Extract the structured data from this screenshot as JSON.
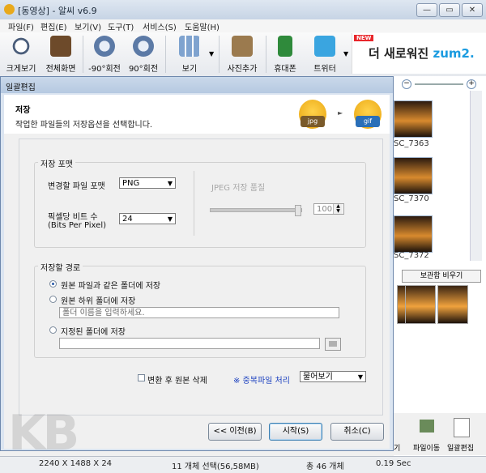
{
  "window": {
    "title": "[동영상] - 알씨 v6.9"
  },
  "menu": [
    "파일(F)",
    "편집(E)",
    "보기(V)",
    "도구(T)",
    "서비스(S)",
    "도움말(H)"
  ],
  "toolbar": {
    "items": [
      {
        "label": "크게보기",
        "icon": "magnifier-icon"
      },
      {
        "label": "전체화면",
        "icon": "fullscreen-icon"
      },
      {
        "label": "-90°회전",
        "icon": "rotate-left-icon"
      },
      {
        "label": "90°회전",
        "icon": "rotate-right-icon"
      },
      {
        "label": "보기",
        "icon": "view-grid-icon"
      },
      {
        "label": "사진추가",
        "icon": "add-photo-icon"
      },
      {
        "label": "휴대폰",
        "icon": "phone-icon"
      },
      {
        "label": "트위터",
        "icon": "twitter-icon"
      }
    ],
    "banner": {
      "badge": "NEW",
      "text": "더 새로워진",
      "brand": "zum",
      "suffix": "2."
    }
  },
  "right_panel": {
    "thumbnails": [
      "SC_7363",
      "SC_7370",
      "SC_7372"
    ],
    "keep_button": "보관함 비우기",
    "bottom_tools": [
      "기",
      "파일이동",
      "일괄편집"
    ]
  },
  "dialog": {
    "title": "일괄편집",
    "heading": "저장",
    "description": "작업한 파일들의 저장옵션을 선택합니다.",
    "mascots": [
      "jpg",
      "gif"
    ],
    "save_format": {
      "legend": "저장 포맷",
      "format_label": "변경할 파일 포맷",
      "format_value": "PNG",
      "bpp_label": "픽셀당 비트 수",
      "bpp_sub": "(Bits Per Pixel)",
      "bpp_value": "24",
      "jpeg_quality_label": "JPEG 저장 품질",
      "jpeg_quality_value": "100",
      "jpeg_quality_level": 1.0
    },
    "save_path": {
      "legend": "저장할 경로",
      "opt_same": "원본 파일과 같은 폴더에 저장",
      "opt_sub": "원본 하위 폴더에 저장",
      "sub_placeholder": "폴더 이름을 입력하세요.",
      "opt_custom": "지정된 폴더에 저장",
      "selected": "same"
    },
    "delete_original": "변환 후 원본 삭제",
    "duplicate_handling": "※ 중복파일 처리",
    "duplicate_value": "물어보기",
    "buttons": {
      "prev": "<< 이전(B)",
      "start": "시작(S)",
      "cancel": "취소(C)"
    }
  },
  "statusbar": {
    "dims": "2240 X 1488 X 24",
    "selection": "11 개체 선택(56,58MB)",
    "total": "총 46 개체",
    "time": "0.19 Sec"
  },
  "watermark": "KB"
}
